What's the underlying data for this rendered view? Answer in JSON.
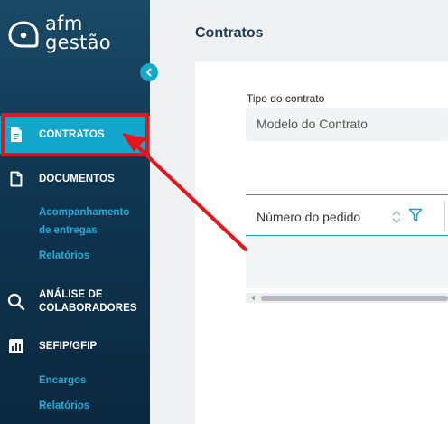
{
  "brand": {
    "line1": "afm",
    "line2": "gestão"
  },
  "sidebar": {
    "items": [
      {
        "label": "CONTRATOS",
        "active": true
      },
      {
        "label": "DOCUMENTOS"
      },
      {
        "label": "ANÁLISE DE COLABORADORES"
      },
      {
        "label": "SEFIP/GFIP"
      }
    ],
    "documentos_sub": [
      "Acompanhamento de entregas",
      "Relatórios"
    ],
    "sefip_sub": [
      "Encargos",
      "Relatórios"
    ]
  },
  "main": {
    "title": "Contratos",
    "contract_type": {
      "label": "Tipo do contrato",
      "value": "Modelo do Contrato"
    },
    "table": {
      "columns": [
        "Número do pedido"
      ]
    }
  },
  "colors": {
    "sidebar": "#0f3550",
    "accent": "#13a7cc",
    "annotation": "#e8141c",
    "link": "#2aa8d6"
  }
}
